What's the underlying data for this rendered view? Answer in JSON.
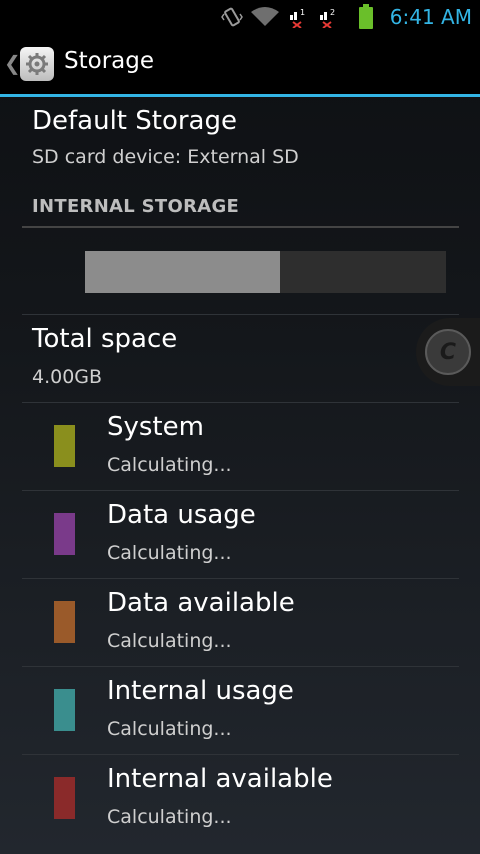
{
  "status": {
    "time": "6:41 AM",
    "icons": [
      "vibrate-icon",
      "wifi-icon",
      "sim1-no-signal-icon",
      "sim2-no-signal-icon",
      "battery-icon"
    ],
    "sim1_label": "1",
    "sim2_label": "2"
  },
  "actionbar": {
    "title": "Storage",
    "icon": "settings-app-icon",
    "accent": "#33b5e5"
  },
  "default_storage": {
    "title": "Default Storage",
    "value": "SD card device: External SD"
  },
  "section_header": "INTERNAL STORAGE",
  "usage_bar": {
    "used_fraction": 0.54
  },
  "total_space": {
    "title": "Total space",
    "value": "4.00GB"
  },
  "categories": [
    {
      "label": "System",
      "status": "Calculating...",
      "color": "#8a8f1d"
    },
    {
      "label": "Data usage",
      "status": "Calculating...",
      "color": "#7a3a8a"
    },
    {
      "label": "Data available",
      "status": "Calculating...",
      "color": "#9a5a2a"
    },
    {
      "label": "Internal usage",
      "status": "Calculating...",
      "color": "#3a8e8e"
    },
    {
      "label": "Internal available",
      "status": "Calculating...",
      "color": "#8a2a2a"
    }
  ],
  "floating_button": {
    "letter": "C"
  }
}
